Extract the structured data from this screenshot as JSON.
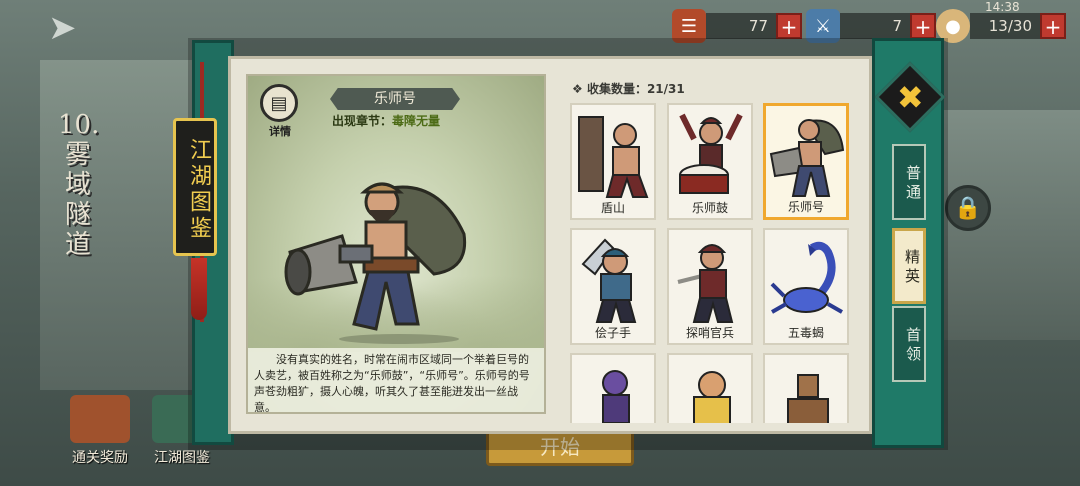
{
  "status_bar": {
    "time": "14:38"
  },
  "resources": [
    {
      "icon": "scroll-icon",
      "value": "77"
    },
    {
      "icon": "sword-icon",
      "value": "7"
    },
    {
      "icon": "bun-icon",
      "value": "13/30"
    }
  ],
  "background": {
    "chapter_title": "10.雾域隧道",
    "start_button": "开始",
    "bottom_buttons": [
      {
        "label": "通关奖励"
      },
      {
        "label": "江湖图鉴"
      }
    ]
  },
  "book": {
    "title_tag": "江湖图鉴",
    "detail": {
      "detail_button_label": "详情",
      "name": "乐师号",
      "chapter_prefix": "出现章节：",
      "chapter_value": "毒障无量",
      "description": "没有真实的姓名，时常在闹市区域同一个举着巨号的人卖艺，被百姓称之为“乐师鼓”，“乐师号”。乐师号的号声苍劲粗犷，摄人心魄，听其久了甚至能迸发出一丝战意。"
    },
    "collection": {
      "label_prefix": "收集数量：",
      "count": "21/31",
      "cards": [
        {
          "name": "盾山",
          "selected": false
        },
        {
          "name": "乐师鼓",
          "selected": false
        },
        {
          "name": "乐师号",
          "selected": true
        },
        {
          "name": "侩子手",
          "selected": false
        },
        {
          "name": "探哨官兵",
          "selected": false
        },
        {
          "name": "五毒蝎",
          "selected": false
        },
        {
          "name": "",
          "selected": false
        },
        {
          "name": "",
          "selected": false
        },
        {
          "name": "",
          "selected": false
        }
      ]
    },
    "tabs": [
      {
        "label": "普通",
        "active": false
      },
      {
        "label": "精英",
        "active": true
      },
      {
        "label": "首领",
        "active": false
      }
    ]
  }
}
